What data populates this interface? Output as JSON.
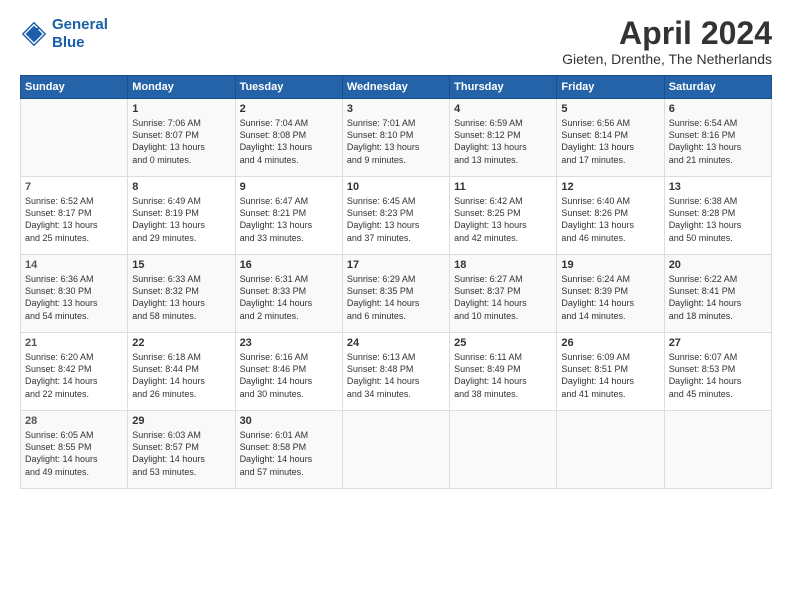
{
  "logo": {
    "line1": "General",
    "line2": "Blue"
  },
  "title": "April 2024",
  "subtitle": "Gieten, Drenthe, The Netherlands",
  "days_of_week": [
    "Sunday",
    "Monday",
    "Tuesday",
    "Wednesday",
    "Thursday",
    "Friday",
    "Saturday"
  ],
  "weeks": [
    [
      {
        "day": "",
        "content": ""
      },
      {
        "day": "1",
        "content": "Sunrise: 7:06 AM\nSunset: 8:07 PM\nDaylight: 13 hours\nand 0 minutes."
      },
      {
        "day": "2",
        "content": "Sunrise: 7:04 AM\nSunset: 8:08 PM\nDaylight: 13 hours\nand 4 minutes."
      },
      {
        "day": "3",
        "content": "Sunrise: 7:01 AM\nSunset: 8:10 PM\nDaylight: 13 hours\nand 9 minutes."
      },
      {
        "day": "4",
        "content": "Sunrise: 6:59 AM\nSunset: 8:12 PM\nDaylight: 13 hours\nand 13 minutes."
      },
      {
        "day": "5",
        "content": "Sunrise: 6:56 AM\nSunset: 8:14 PM\nDaylight: 13 hours\nand 17 minutes."
      },
      {
        "day": "6",
        "content": "Sunrise: 6:54 AM\nSunset: 8:16 PM\nDaylight: 13 hours\nand 21 minutes."
      }
    ],
    [
      {
        "day": "7",
        "content": "Sunrise: 6:52 AM\nSunset: 8:17 PM\nDaylight: 13 hours\nand 25 minutes."
      },
      {
        "day": "8",
        "content": "Sunrise: 6:49 AM\nSunset: 8:19 PM\nDaylight: 13 hours\nand 29 minutes."
      },
      {
        "day": "9",
        "content": "Sunrise: 6:47 AM\nSunset: 8:21 PM\nDaylight: 13 hours\nand 33 minutes."
      },
      {
        "day": "10",
        "content": "Sunrise: 6:45 AM\nSunset: 8:23 PM\nDaylight: 13 hours\nand 37 minutes."
      },
      {
        "day": "11",
        "content": "Sunrise: 6:42 AM\nSunset: 8:25 PM\nDaylight: 13 hours\nand 42 minutes."
      },
      {
        "day": "12",
        "content": "Sunrise: 6:40 AM\nSunset: 8:26 PM\nDaylight: 13 hours\nand 46 minutes."
      },
      {
        "day": "13",
        "content": "Sunrise: 6:38 AM\nSunset: 8:28 PM\nDaylight: 13 hours\nand 50 minutes."
      }
    ],
    [
      {
        "day": "14",
        "content": "Sunrise: 6:36 AM\nSunset: 8:30 PM\nDaylight: 13 hours\nand 54 minutes."
      },
      {
        "day": "15",
        "content": "Sunrise: 6:33 AM\nSunset: 8:32 PM\nDaylight: 13 hours\nand 58 minutes."
      },
      {
        "day": "16",
        "content": "Sunrise: 6:31 AM\nSunset: 8:33 PM\nDaylight: 14 hours\nand 2 minutes."
      },
      {
        "day": "17",
        "content": "Sunrise: 6:29 AM\nSunset: 8:35 PM\nDaylight: 14 hours\nand 6 minutes."
      },
      {
        "day": "18",
        "content": "Sunrise: 6:27 AM\nSunset: 8:37 PM\nDaylight: 14 hours\nand 10 minutes."
      },
      {
        "day": "19",
        "content": "Sunrise: 6:24 AM\nSunset: 8:39 PM\nDaylight: 14 hours\nand 14 minutes."
      },
      {
        "day": "20",
        "content": "Sunrise: 6:22 AM\nSunset: 8:41 PM\nDaylight: 14 hours\nand 18 minutes."
      }
    ],
    [
      {
        "day": "21",
        "content": "Sunrise: 6:20 AM\nSunset: 8:42 PM\nDaylight: 14 hours\nand 22 minutes."
      },
      {
        "day": "22",
        "content": "Sunrise: 6:18 AM\nSunset: 8:44 PM\nDaylight: 14 hours\nand 26 minutes."
      },
      {
        "day": "23",
        "content": "Sunrise: 6:16 AM\nSunset: 8:46 PM\nDaylight: 14 hours\nand 30 minutes."
      },
      {
        "day": "24",
        "content": "Sunrise: 6:13 AM\nSunset: 8:48 PM\nDaylight: 14 hours\nand 34 minutes."
      },
      {
        "day": "25",
        "content": "Sunrise: 6:11 AM\nSunset: 8:49 PM\nDaylight: 14 hours\nand 38 minutes."
      },
      {
        "day": "26",
        "content": "Sunrise: 6:09 AM\nSunset: 8:51 PM\nDaylight: 14 hours\nand 41 minutes."
      },
      {
        "day": "27",
        "content": "Sunrise: 6:07 AM\nSunset: 8:53 PM\nDaylight: 14 hours\nand 45 minutes."
      }
    ],
    [
      {
        "day": "28",
        "content": "Sunrise: 6:05 AM\nSunset: 8:55 PM\nDaylight: 14 hours\nand 49 minutes."
      },
      {
        "day": "29",
        "content": "Sunrise: 6:03 AM\nSunset: 8:57 PM\nDaylight: 14 hours\nand 53 minutes."
      },
      {
        "day": "30",
        "content": "Sunrise: 6:01 AM\nSunset: 8:58 PM\nDaylight: 14 hours\nand 57 minutes."
      },
      {
        "day": "",
        "content": ""
      },
      {
        "day": "",
        "content": ""
      },
      {
        "day": "",
        "content": ""
      },
      {
        "day": "",
        "content": ""
      }
    ]
  ]
}
